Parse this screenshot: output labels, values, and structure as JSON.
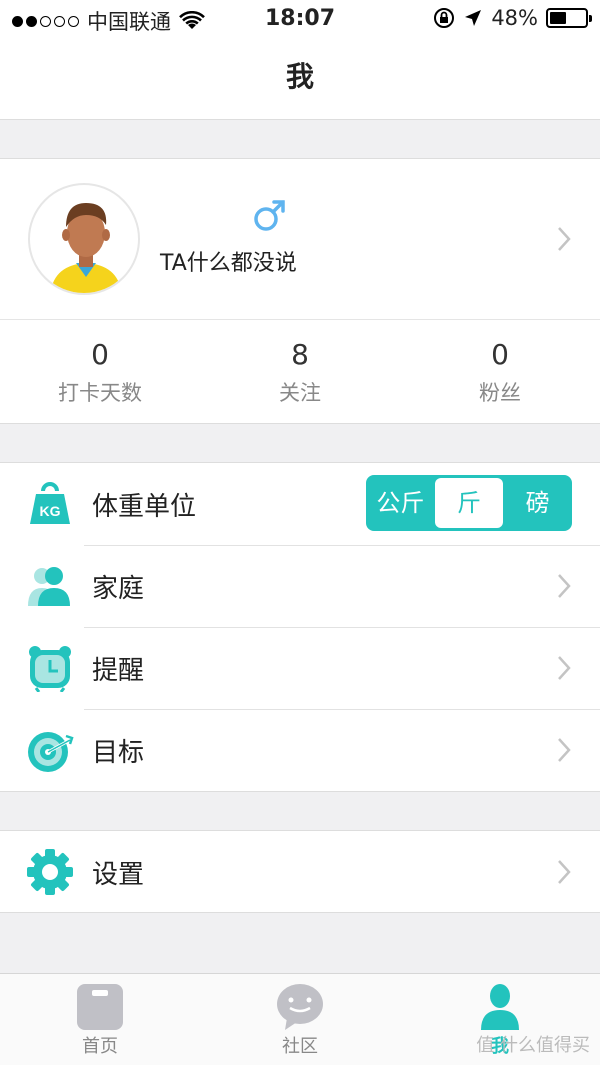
{
  "status_bar": {
    "carrier": "中国联通",
    "time": "18:07",
    "battery_percent": "48%",
    "battery_level": 0.48,
    "signal_bars": 2
  },
  "nav": {
    "title": "我"
  },
  "profile": {
    "signature": "TA什么都没说",
    "gender_icon": "male-icon",
    "gender_color": "#5fb4ef"
  },
  "stats": [
    {
      "value": "0",
      "label": "打卡天数"
    },
    {
      "value": "8",
      "label": "关注"
    },
    {
      "value": "0",
      "label": "粉丝"
    }
  ],
  "menu": {
    "weight_unit": {
      "label": "体重单位",
      "icon_text": "KG",
      "options": [
        "公斤",
        "斤",
        "磅"
      ],
      "selected": "斤"
    },
    "family": {
      "label": "家庭"
    },
    "reminder": {
      "label": "提醒"
    },
    "goal": {
      "label": "目标"
    }
  },
  "settings": {
    "label": "设置"
  },
  "tabs": [
    {
      "label": "首页",
      "icon": "home-scale-icon",
      "active": false
    },
    {
      "label": "社区",
      "icon": "chat-bubble-icon",
      "active": false
    },
    {
      "label": "我",
      "icon": "person-icon",
      "active": true
    }
  ],
  "watermark": "值 什么值得买",
  "colors": {
    "accent": "#23c3bd",
    "inactive": "#c0c0c6"
  }
}
